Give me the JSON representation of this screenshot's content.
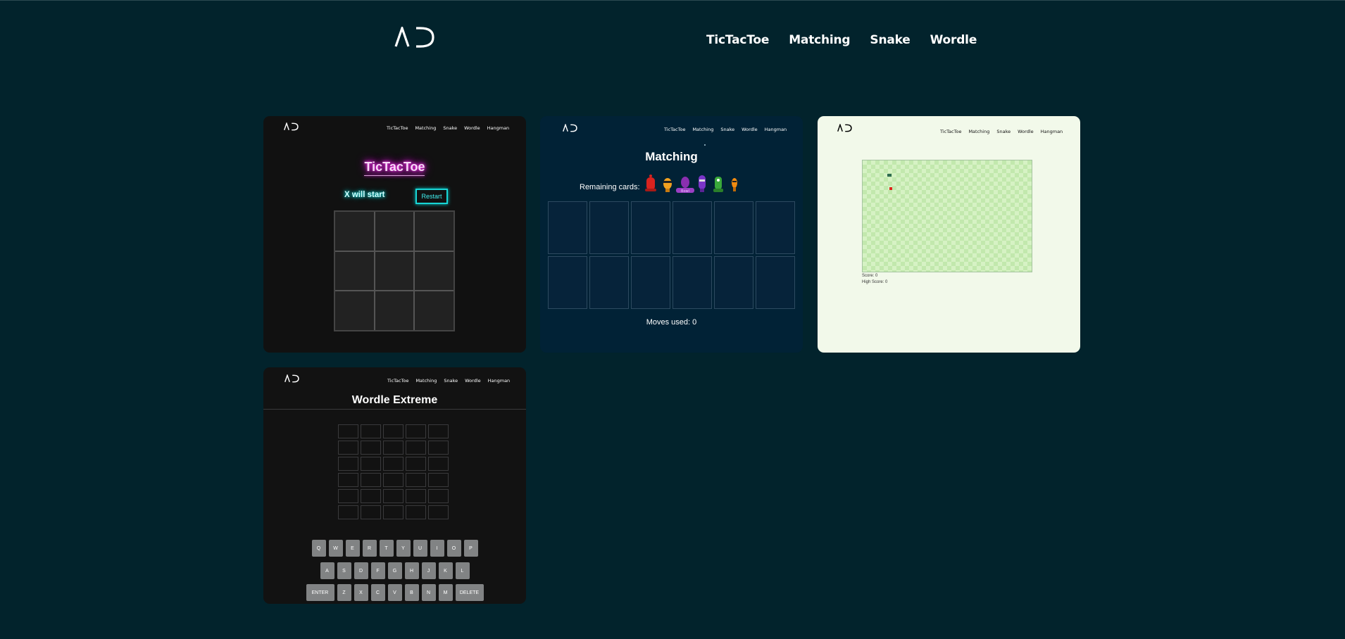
{
  "header": {
    "logo_text": "AD",
    "nav": [
      {
        "label": "TicTacToe"
      },
      {
        "label": "Matching"
      },
      {
        "label": "Snake"
      },
      {
        "label": "Wordle"
      }
    ]
  },
  "mini_nav": [
    "TicTacToe",
    "Matching",
    "Snake",
    "Wordle",
    "Hangman"
  ],
  "tictactoe": {
    "title": "TicTacToe",
    "status": "X will start",
    "restart_label": "Restart"
  },
  "matching": {
    "title": "Matching",
    "remaining_label": "Remaining cards:",
    "moves_text": "Moves used: 0",
    "character_badge": "Bowl"
  },
  "snake": {
    "score_text": "Score: 0",
    "high_score_text": "High Score: 0"
  },
  "wordle": {
    "title": "Wordle Extreme",
    "keyboard": {
      "row1": [
        "Q",
        "W",
        "E",
        "R",
        "T",
        "Y",
        "U",
        "I",
        "O",
        "P"
      ],
      "row2": [
        "A",
        "S",
        "D",
        "F",
        "G",
        "H",
        "J",
        "K",
        "L"
      ],
      "row3": [
        "ENTER",
        "Z",
        "X",
        "C",
        "V",
        "B",
        "N",
        "M",
        "DELETE"
      ]
    }
  },
  "colors": {
    "page_bg": "#02232c",
    "tictactoe_bg": "#111111",
    "matching_bg": "#012236",
    "snake_bg": "#f2f9ea",
    "wordle_bg": "#121212",
    "neon_pink": "#ff2bf0",
    "neon_cyan": "#19d6d6",
    "snake_head": "#2e6b4f",
    "snake_food": "#e0241c"
  }
}
